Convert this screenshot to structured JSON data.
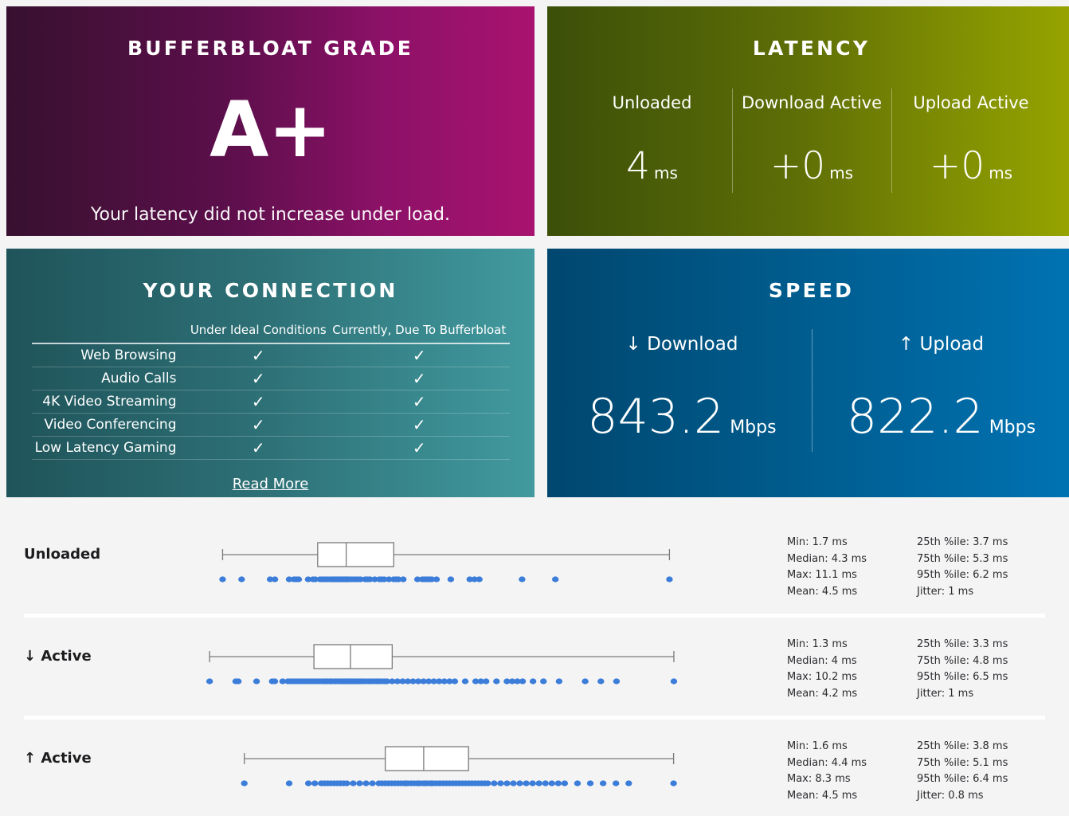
{
  "grade_card": {
    "title": "BUFFERBLOAT GRADE",
    "grade": "A+",
    "subtitle": "Your latency did not increase under load."
  },
  "latency_card": {
    "title": "LATENCY",
    "columns": [
      {
        "label": "Unloaded",
        "value": "4",
        "unit": "ms"
      },
      {
        "label": "Download Active",
        "value": "+0",
        "unit": "ms"
      },
      {
        "label": "Upload Active",
        "value": "+0",
        "unit": "ms"
      }
    ]
  },
  "connection_card": {
    "title": "YOUR CONNECTION",
    "headers": [
      "",
      "Under Ideal Conditions",
      "Currently, Due To Bufferbloat"
    ],
    "rows": [
      {
        "task": "Web Browsing",
        "ideal": "✓",
        "current": "✓"
      },
      {
        "task": "Audio Calls",
        "ideal": "✓",
        "current": "✓"
      },
      {
        "task": "4K Video Streaming",
        "ideal": "✓",
        "current": "✓"
      },
      {
        "task": "Video Conferencing",
        "ideal": "✓",
        "current": "✓"
      },
      {
        "task": "Low Latency Gaming",
        "ideal": "✓",
        "current": "✓"
      }
    ],
    "read_more": "Read More"
  },
  "speed_card": {
    "title": "SPEED",
    "columns": [
      {
        "label": "↓ Download",
        "value": "843.2",
        "unit": "Mbps"
      },
      {
        "label": "↑ Upload",
        "value": "822.2",
        "unit": "Mbps"
      }
    ]
  },
  "colors": {
    "page_background": "#f4f4f5",
    "grade_gradient_from": "#37102f",
    "grade_gradient_to": "#a8136f",
    "latency_gradient_from": "#3b4f09",
    "latency_gradient_to": "#97a400",
    "connection_gradient_from": "#1f545a",
    "connection_gradient_to": "#429a9e",
    "speed_gradient_from": "#00476f",
    "speed_gradient_to": "#0073b3",
    "scatter_point": "#3b7dd8",
    "box_stroke": "#7a7a7a",
    "divider": "#ffffff"
  },
  "chart_data": [
    {
      "type": "box",
      "name": "Unloaded",
      "label": "Unloaded",
      "xlabel": "",
      "ylabel": "",
      "grid": false,
      "xlim": [
        0,
        12.4
      ],
      "box": {
        "min": 1.7,
        "q1": 3.7,
        "median": 4.3,
        "q3": 5.3,
        "max": 11.1
      },
      "stats_left": [
        "Min: 1.7 ms",
        "Median: 4.3 ms",
        "Max: 11.1 ms",
        "Mean: 4.5 ms"
      ],
      "stats_right": [
        "25th %ile: 3.7 ms",
        "75th %ile: 5.3 ms",
        "95th %ile: 6.2 ms",
        "Jitter: 1 ms"
      ],
      "stats": {
        "min": 1.7,
        "median": 4.3,
        "max": 11.1,
        "mean": 4.5,
        "p25": 3.7,
        "p75": 5.3,
        "p95": 6.2,
        "jitter": 1
      },
      "points": [
        1.7,
        2.1,
        2.7,
        2.8,
        3.1,
        3.2,
        3.25,
        3.3,
        3.5,
        3.6,
        3.65,
        3.75,
        3.8,
        3.85,
        3.9,
        3.95,
        4.0,
        4.02,
        4.05,
        4.08,
        4.1,
        4.12,
        4.15,
        4.18,
        4.2,
        4.22,
        4.25,
        4.28,
        4.3,
        4.32,
        4.35,
        4.4,
        4.45,
        4.5,
        4.55,
        4.6,
        4.7,
        4.75,
        4.8,
        4.9,
        5.0,
        5.05,
        5.1,
        5.2,
        5.3,
        5.35,
        5.4,
        5.5,
        5.8,
        5.9,
        5.95,
        6.0,
        6.05,
        6.1,
        6.2,
        6.5,
        6.9,
        7.0,
        7.1,
        8.0,
        8.7,
        11.1
      ]
    },
    {
      "type": "box",
      "name": "Download Active",
      "label": "↓ Active",
      "xlabel": "",
      "ylabel": "",
      "grid": false,
      "xlim": [
        0,
        11.3
      ],
      "box": {
        "min": 1.3,
        "q1": 3.3,
        "median": 4.0,
        "q3": 4.8,
        "max": 10.2
      },
      "stats_left": [
        "Min: 1.3 ms",
        "Median: 4 ms",
        "Max: 10.2 ms",
        "Mean: 4.2 ms"
      ],
      "stats_right": [
        "25th %ile: 3.3 ms",
        "75th %ile: 4.8 ms",
        "95th %ile: 6.5 ms",
        "Jitter: 1 ms"
      ],
      "stats": {
        "min": 1.3,
        "median": 4,
        "max": 10.2,
        "mean": 4.2,
        "p25": 3.3,
        "p75": 4.8,
        "p95": 6.5,
        "jitter": 1
      },
      "points": [
        1.3,
        1.8,
        1.85,
        2.2,
        2.5,
        2.55,
        2.7,
        2.8,
        2.85,
        2.9,
        2.95,
        3.0,
        3.05,
        3.1,
        3.15,
        3.2,
        3.25,
        3.3,
        3.35,
        3.4,
        3.45,
        3.5,
        3.52,
        3.55,
        3.6,
        3.62,
        3.65,
        3.7,
        3.72,
        3.75,
        3.8,
        3.82,
        3.85,
        3.88,
        3.9,
        3.92,
        3.95,
        3.98,
        4.0,
        4.02,
        4.05,
        4.08,
        4.1,
        4.12,
        4.15,
        4.18,
        4.2,
        4.25,
        4.3,
        4.35,
        4.4,
        4.45,
        4.5,
        4.55,
        4.6,
        4.65,
        4.7,
        4.8,
        4.9,
        5.0,
        5.1,
        5.2,
        5.3,
        5.4,
        5.5,
        5.6,
        5.7,
        5.8,
        5.9,
        6.0,
        6.2,
        6.4,
        6.5,
        6.6,
        6.8,
        7.0,
        7.1,
        7.2,
        7.3,
        7.5,
        7.7,
        8.0,
        8.5,
        8.8,
        9.1,
        10.2
      ]
    },
    {
      "type": "box",
      "name": "Upload Active",
      "label": "↑ Active",
      "xlabel": "",
      "ylabel": "",
      "grid": false,
      "xlim": [
        0,
        9.2
      ],
      "box": {
        "min": 1.6,
        "q1": 3.8,
        "median": 4.4,
        "q3": 5.1,
        "max": 8.3
      },
      "stats_left": [
        "Min: 1.6 ms",
        "Median: 4.4 ms",
        "Max: 8.3 ms",
        "Mean: 4.5 ms"
      ],
      "stats_right": [
        "25th %ile: 3.8 ms",
        "75th %ile: 5.1 ms",
        "95th %ile: 6.4 ms",
        "Jitter: 0.8 ms"
      ],
      "stats": {
        "min": 1.6,
        "median": 4.4,
        "max": 8.3,
        "mean": 4.5,
        "p25": 3.8,
        "p75": 5.1,
        "p95": 6.4,
        "jitter": 0.8
      },
      "points": [
        1.6,
        2.3,
        2.6,
        2.7,
        2.8,
        2.85,
        2.9,
        2.95,
        3.0,
        3.05,
        3.1,
        3.15,
        3.2,
        3.3,
        3.4,
        3.5,
        3.6,
        3.7,
        3.75,
        3.8,
        3.85,
        3.9,
        3.95,
        4.0,
        4.05,
        4.1,
        4.12,
        4.15,
        4.2,
        4.25,
        4.3,
        4.32,
        4.35,
        4.4,
        4.42,
        4.45,
        4.5,
        4.52,
        4.55,
        4.6,
        4.65,
        4.7,
        4.75,
        4.8,
        4.85,
        4.9,
        4.95,
        5.0,
        5.05,
        5.1,
        5.15,
        5.2,
        5.25,
        5.3,
        5.35,
        5.4,
        5.5,
        5.6,
        5.7,
        5.8,
        5.9,
        6.0,
        6.1,
        6.2,
        6.3,
        6.4,
        6.5,
        6.6,
        6.8,
        7.0,
        7.2,
        7.4,
        7.6,
        8.3
      ]
    }
  ]
}
